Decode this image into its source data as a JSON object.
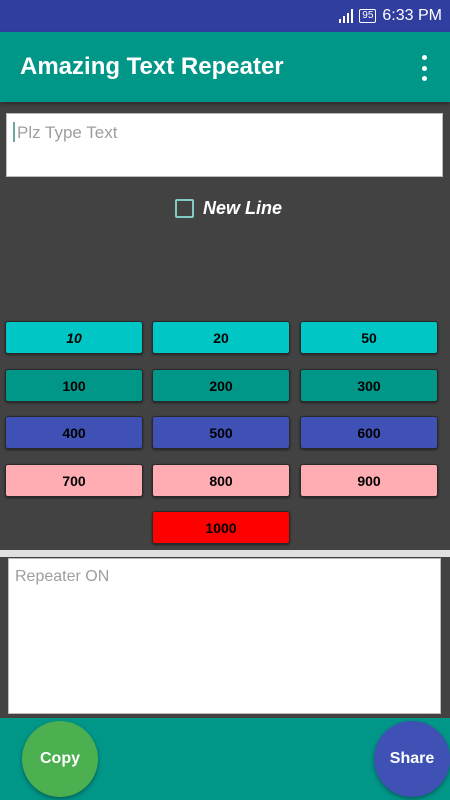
{
  "status_bar": {
    "battery": "95",
    "time": "6:33 PM"
  },
  "app_bar": {
    "title": "Amazing Text Repeater"
  },
  "input": {
    "placeholder": "Plz Type Text"
  },
  "new_line": {
    "label": "New Line",
    "checked": false
  },
  "repeat_buttons": [
    "10",
    "20",
    "50",
    "100",
    "200",
    "300",
    "400",
    "500",
    "600",
    "700",
    "800",
    "900",
    "1000"
  ],
  "output": {
    "placeholder": "Repeater ON"
  },
  "actions": {
    "copy_label": "Copy",
    "share_label": "Share"
  },
  "colors": {
    "status_bar": "#303f9f",
    "app_bar": "#009688",
    "row1": "#00c6c6",
    "row2": "#009688",
    "row3": "#3f51b5",
    "row4": "#ffadb3",
    "row5": "#ff0000",
    "copy_fab": "#4caf50",
    "share_fab": "#3f51b5"
  }
}
